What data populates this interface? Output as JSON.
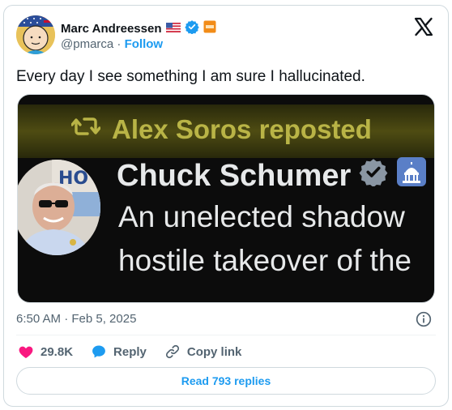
{
  "author": {
    "name": "Marc Andreessen",
    "handle": "@pmarca",
    "separator": "·",
    "follow_label": "Follow",
    "badges": [
      "us-flag-icon",
      "verified-badge-icon",
      "affiliate-badge-icon"
    ]
  },
  "tweet": {
    "text": "Every day I see something I am sure I hallucinated.",
    "timestamp": "6:50 AM · Feb 5, 2025"
  },
  "media": {
    "repost_text": "Alex Soros reposted",
    "quoted_name": "Chuck Schumer",
    "quoted_line1": "An unelected shadow",
    "quoted_line2": "hostile takeover of the",
    "photo_sign_text": "HO"
  },
  "actions": {
    "likes": "29.8K",
    "reply_label": "Reply",
    "copy_link_label": "Copy link"
  },
  "read_replies_label": "Read 793 replies",
  "colors": {
    "accent": "#1d9bf0",
    "like": "#f91880",
    "muted": "#536471",
    "repost_olive": "#b9b446"
  }
}
